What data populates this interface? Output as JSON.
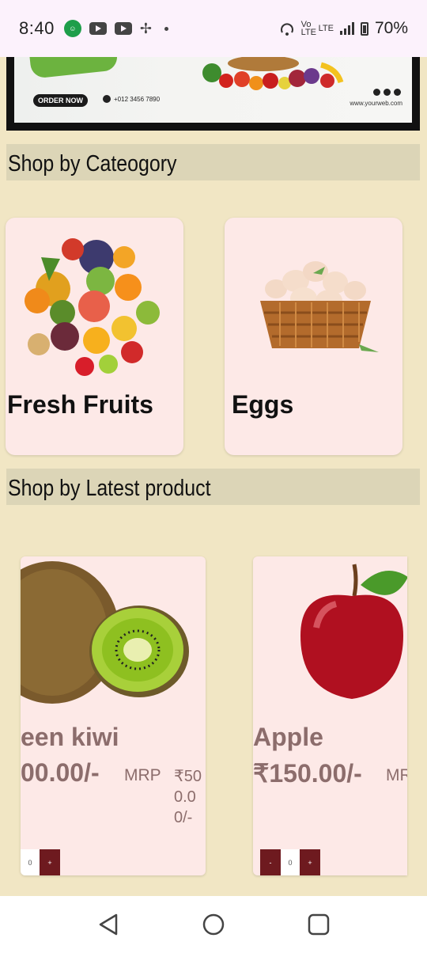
{
  "status_bar": {
    "time": "8:40",
    "volte_label": "Vo LTE",
    "lte_label": "LTE",
    "battery": "70%",
    "icons": [
      "app-notification-icon",
      "youtube-icon",
      "youtube-icon",
      "pinwheel-icon",
      "dot-icon",
      "hotspot-icon",
      "signal-icon",
      "battery-icon"
    ]
  },
  "banner": {
    "order_button": "ORDER NOW",
    "phone": "+012 3456 7890",
    "website": "www.yourweb.com"
  },
  "sections": {
    "categories_title": "Shop by Cateogory",
    "latest_title": "Shop by Latest product"
  },
  "categories": [
    {
      "label": "Fresh Fruits"
    },
    {
      "label": "Eggs"
    }
  ],
  "products": [
    {
      "name": "een kiwi",
      "price": "00.00/-",
      "mrp_label": "MRP",
      "mrp_value": "₹500.00/-",
      "qty_minus": "-",
      "qty_value": "0",
      "qty_plus": "+"
    },
    {
      "name": "Apple",
      "price": "₹150.00/-",
      "mrp_label": "MRP",
      "qty_minus": "-",
      "qty_value": "0",
      "qty_plus": "+"
    }
  ],
  "nav": {
    "icons": [
      "back-icon",
      "home-icon",
      "recents-icon"
    ]
  },
  "colors": {
    "page_bg": "#f1e6c4",
    "section_bg": "#dcd5b7",
    "card_bg": "#fde9e7",
    "product_text": "#8c6d6c",
    "qty_button": "#6e1a1f"
  }
}
